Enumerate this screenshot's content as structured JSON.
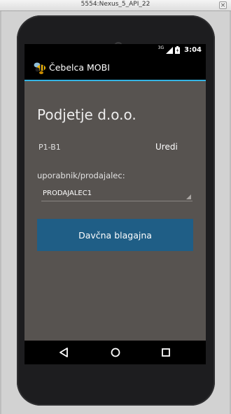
{
  "window": {
    "title": "5554:Nexus_5_API_22",
    "close_glyph": "×"
  },
  "statusbar": {
    "network": "3G",
    "time": "3:04",
    "signal_icon": "signal-icon",
    "battery_icon": "battery-icon"
  },
  "actionbar": {
    "app_title": "Čebelca MOBI",
    "app_icon": "bee-icon",
    "accent_color": "#33b5e5"
  },
  "main": {
    "company_name": "Podjetje d.o.o.",
    "device_code": "P1-B1",
    "edit_label": "Uredi",
    "user_label": "uporabnik/prodajalec:",
    "user_select_value": "PRODAJALEC1",
    "primary_button_label": "Davčna blagajna",
    "primary_button_color": "#1f5e86",
    "background_color": "#575350"
  },
  "navbar": {
    "back_icon": "back-icon",
    "home_icon": "home-icon",
    "recents_icon": "recents-icon"
  }
}
